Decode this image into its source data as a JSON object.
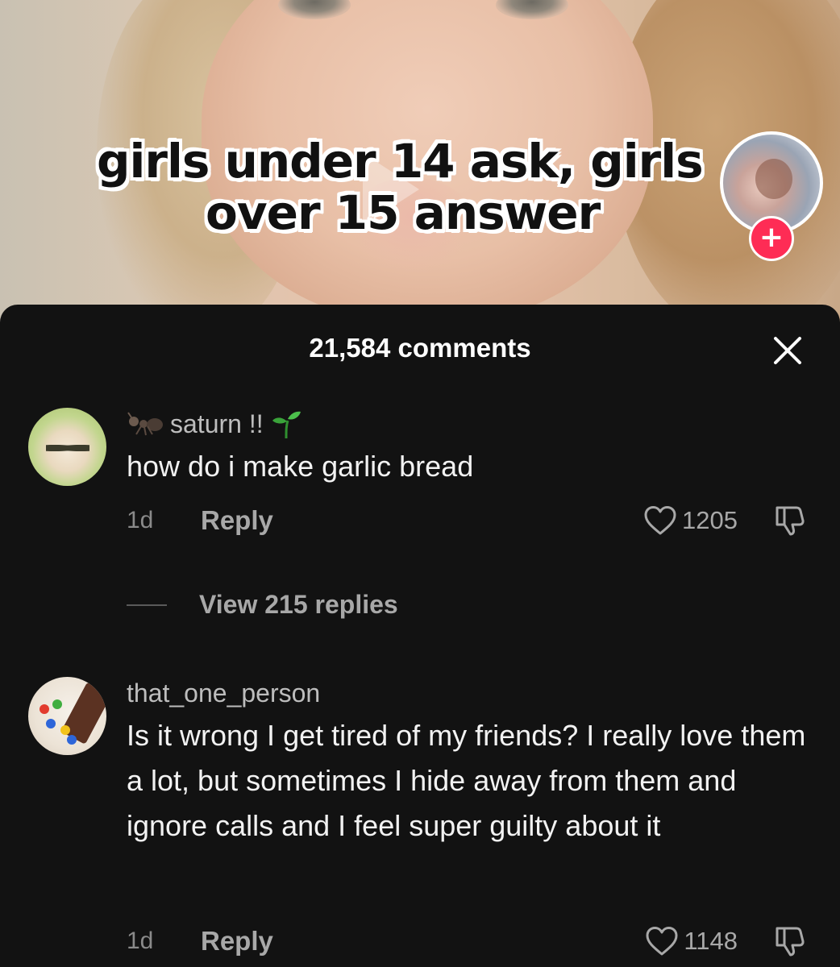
{
  "video": {
    "caption_line1": "girls under 14 ask, girls",
    "caption_line2": "over 15 answer",
    "follow_symbol": "+"
  },
  "comments_sheet": {
    "title": "21,584 comments",
    "close_icon": "close-icon"
  },
  "comments": [
    {
      "username": "saturn !!",
      "text": "how do i make garlic bread",
      "time": "1d",
      "reply_label": "Reply",
      "likes": "1205",
      "view_replies": "View 215 replies"
    },
    {
      "username": "that_one_person",
      "text": "Is it wrong I get tired of my friends? I really love them a lot, but sometimes I hide away from them and ignore calls and I feel super guilty about it",
      "time": "1d",
      "reply_label": "Reply",
      "likes": "1148"
    }
  ],
  "colors": {
    "sheet_bg": "#121212",
    "follow_accent": "#fe2c55",
    "username": "#bdbdbd",
    "muted_text": "#a8a8a8"
  }
}
